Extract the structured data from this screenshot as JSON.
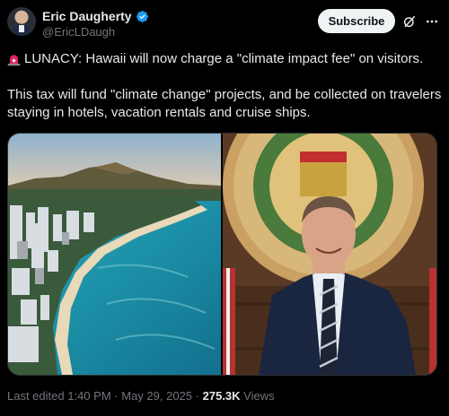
{
  "author": {
    "display_name": "Eric Daugherty",
    "handle": "@EricLDaugh",
    "verified": true
  },
  "actions": {
    "subscribe_label": "Subscribe",
    "grok_icon": "grok-icon",
    "more_icon": "more-icon"
  },
  "tweet": {
    "line1_icon": "siren-icon",
    "line1": "LUNACY: Hawaii will now charge a \"climate impact fee\" on visitors.",
    "line2": "This tax will fund \"climate change\" projects, and be collected on travelers staying in hotels, vacation rentals and cruise ships."
  },
  "media": {
    "left_image": "aerial photo of Waikiki beach and Diamond Head",
    "right_image": "man in suit in front of Hawaii state seal"
  },
  "meta": {
    "edited_prefix": "Last edited",
    "time": "1:40 PM",
    "separator1": "·",
    "date": "May 29, 2025",
    "separator2": "·",
    "views_count": "275.3K",
    "views_label": "Views"
  },
  "colors": {
    "background": "#000000",
    "text_primary": "#e7e9ea",
    "text_secondary": "#71767b",
    "verified_blue": "#1d9bf0",
    "subscribe_bg": "#eff3f4"
  }
}
